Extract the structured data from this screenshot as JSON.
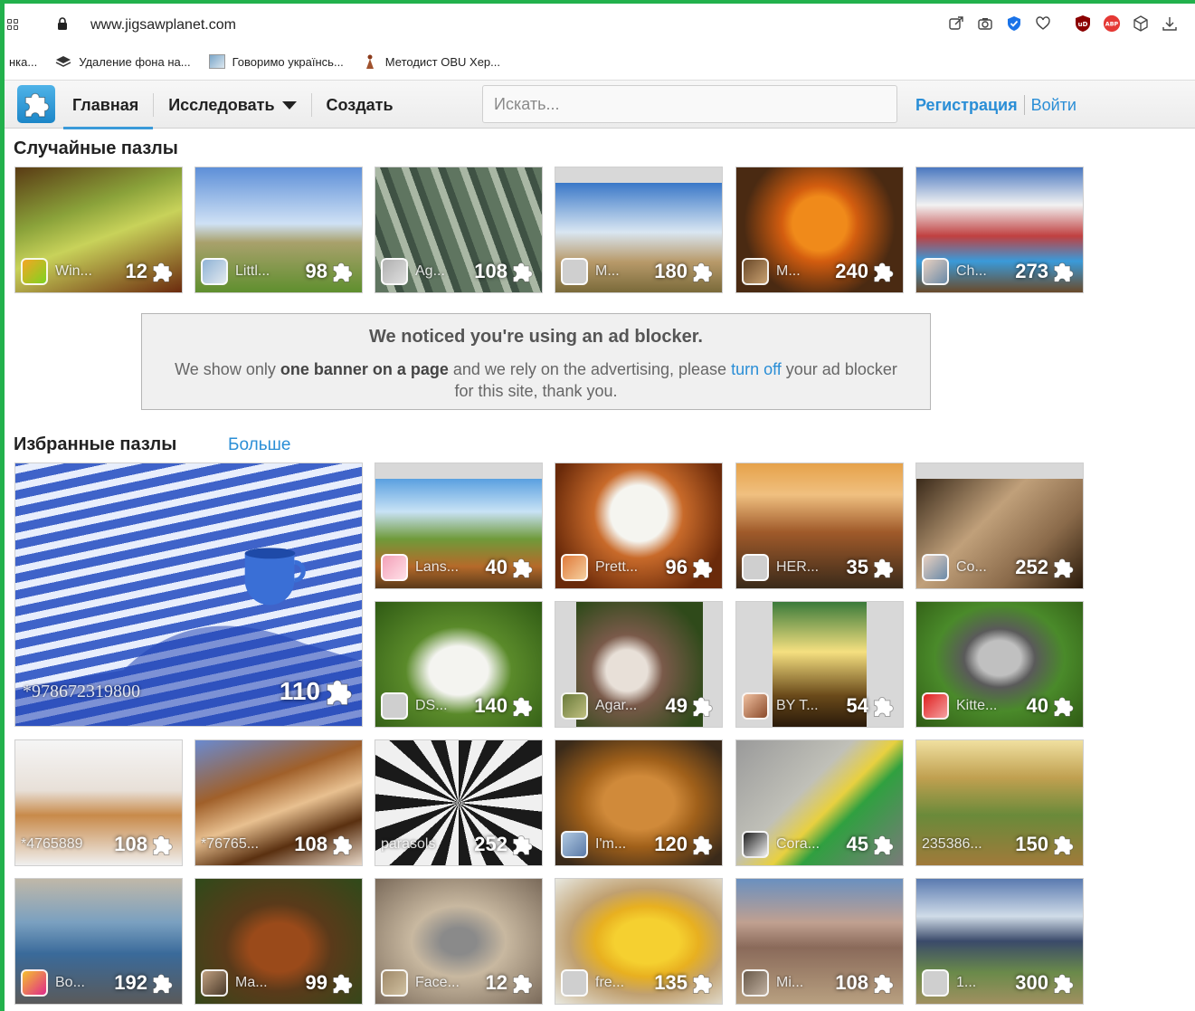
{
  "browser": {
    "url": "www.jigsawplanet.com",
    "bookmarks": [
      {
        "label": "нка..."
      },
      {
        "label": "Удаление фона на..."
      },
      {
        "label": "Говоримо українсь..."
      },
      {
        "label": "Методист OBU Хер..."
      }
    ]
  },
  "header": {
    "nav": [
      {
        "label": "Главная"
      },
      {
        "label": "Исследовать"
      },
      {
        "label": "Создать"
      }
    ],
    "search_placeholder": "Искать...",
    "register": "Регистрация",
    "login": "Войти"
  },
  "random": {
    "title": "Случайные пазлы",
    "tiles": [
      {
        "name": "Win...",
        "count": "12"
      },
      {
        "name": "Littl...",
        "count": "98"
      },
      {
        "name": "Ag...",
        "count": "108"
      },
      {
        "name": "M...",
        "count": "180"
      },
      {
        "name": "M...",
        "count": "240"
      },
      {
        "name": "Ch...",
        "count": "273"
      }
    ]
  },
  "adblock": {
    "title": "We noticed you're using an ad blocker.",
    "p1": "We show only ",
    "bold": "one banner on a page",
    "p2": " and we rely on the advertising, please ",
    "link": "turn off",
    "p3": " your ad blocker for this site, thank you."
  },
  "featured": {
    "title": "Избранные пазлы",
    "more": "Больше",
    "big": {
      "name": "*978672319800",
      "count": "110"
    },
    "tiles": [
      {
        "name": "Lans...",
        "count": "40"
      },
      {
        "name": "Prett...",
        "count": "96"
      },
      {
        "name": "HER...",
        "count": "35"
      },
      {
        "name": "Co...",
        "count": "252"
      },
      {
        "name": "DS...",
        "count": "140"
      },
      {
        "name": "Agar...",
        "count": "49"
      },
      {
        "name": "BY T...",
        "count": "54"
      },
      {
        "name": "Kitte...",
        "count": "40"
      },
      {
        "name": "*4765889",
        "count": "108"
      },
      {
        "name": "*76765...",
        "count": "108"
      },
      {
        "name": "parasols",
        "count": "252"
      },
      {
        "name": "I'm...",
        "count": "120"
      },
      {
        "name": "Cora...",
        "count": "45"
      },
      {
        "name": "235386...",
        "count": "150"
      },
      {
        "name": "Bo...",
        "count": "192"
      },
      {
        "name": "Ma...",
        "count": "99"
      },
      {
        "name": "Face...",
        "count": "12"
      },
      {
        "name": "fre...",
        "count": "135"
      },
      {
        "name": "Mi...",
        "count": "108"
      },
      {
        "name": "1...",
        "count": "300"
      }
    ]
  },
  "colors": {
    "accent": "#2a8ed6",
    "frame": "#22b14c"
  }
}
